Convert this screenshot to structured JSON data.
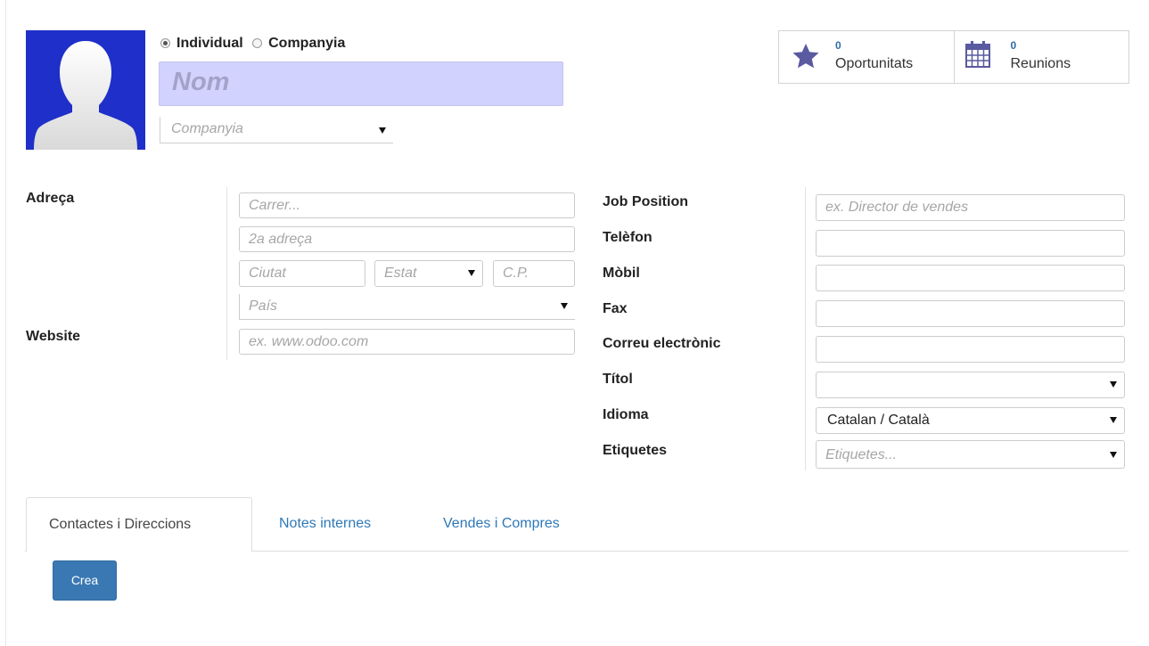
{
  "header": {
    "type_options": [
      {
        "label": "Individual",
        "checked": true
      },
      {
        "label": "Companyia",
        "checked": false
      }
    ],
    "name_placeholder": "Nom",
    "company_placeholder": "Companyia"
  },
  "smart_buttons": [
    {
      "count": "0",
      "label": "Oportunitats",
      "icon": "star-icon"
    },
    {
      "count": "0",
      "label": "Reunions",
      "icon": "calendar-icon"
    }
  ],
  "address": {
    "label": "Adreça",
    "street_placeholder": "Carrer...",
    "street2_placeholder": "2a adreça",
    "city_placeholder": "Ciutat",
    "state_placeholder": "Estat",
    "zip_placeholder": "C.P.",
    "country_placeholder": "País"
  },
  "website": {
    "label": "Website",
    "placeholder": "ex. www.odoo.com"
  },
  "right_fields": {
    "job_position": {
      "label": "Job Position",
      "placeholder": "ex. Director de vendes"
    },
    "phone": {
      "label": "Telèfon",
      "value": ""
    },
    "mobile": {
      "label": "Mòbil",
      "value": ""
    },
    "fax": {
      "label": "Fax",
      "value": ""
    },
    "email": {
      "label": "Correu electrònic",
      "value": ""
    },
    "title": {
      "label": "Títol",
      "value": ""
    },
    "language": {
      "label": "Idioma",
      "value": "Catalan / Català"
    },
    "tags": {
      "label": "Etiquetes",
      "placeholder": "Etiquetes..."
    }
  },
  "tabs": [
    {
      "label": "Contactes i Direccions",
      "active": true
    },
    {
      "label": "Notes internes",
      "active": false
    },
    {
      "label": "Vendes i Compres",
      "active": false
    }
  ],
  "create_button": "Crea",
  "colors": {
    "avatar_bg": "#1f2fc9",
    "name_field_bg": "#d2d2ff",
    "link": "#2e78b8",
    "primary_button": "#3a78b3",
    "smart_icon": "#5a5aa0"
  }
}
